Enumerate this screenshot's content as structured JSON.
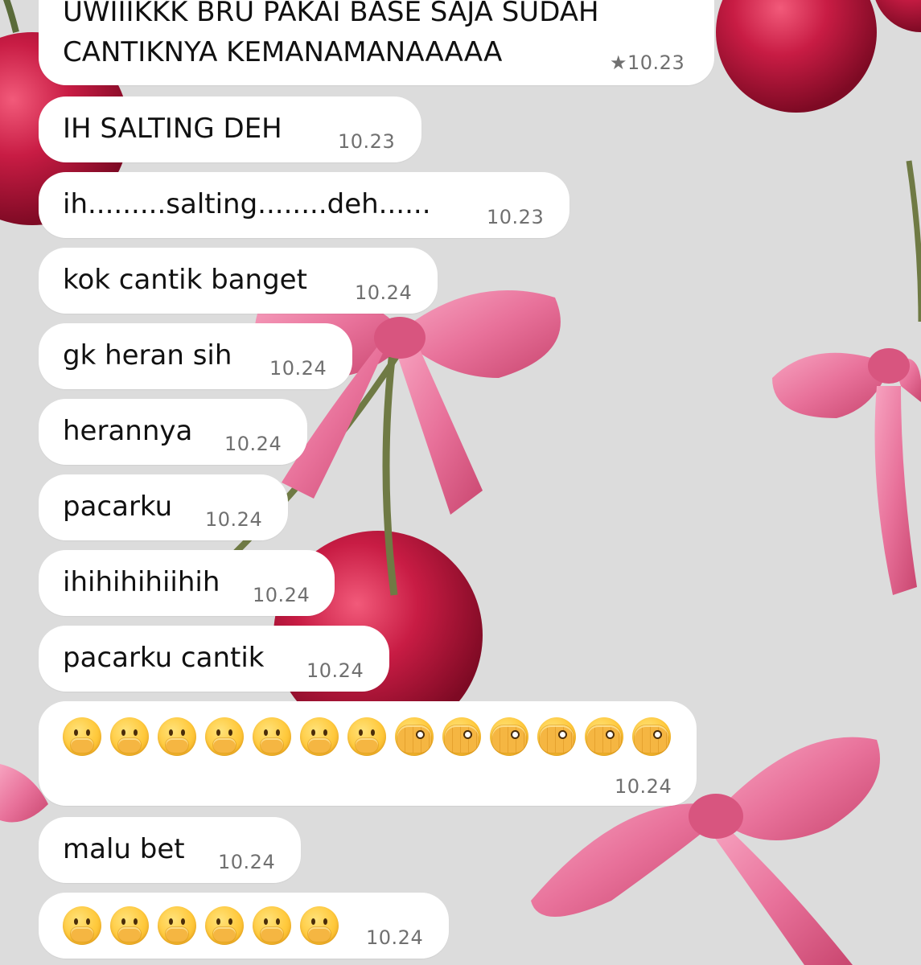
{
  "messages": [
    {
      "line1": "UWIIIKKK BRU PAKAI BASE SAJA SUDAH",
      "line2": "CANTIKNYA KEMANAMANAAAAA",
      "starred": true,
      "star": "★",
      "time": "10.23"
    },
    {
      "text": "IH SALTING DEH",
      "time": "10.23"
    },
    {
      "text": "ih.........salting........deh......",
      "time": "10.23"
    },
    {
      "text": "kok cantik banget",
      "time": "10.24"
    },
    {
      "text": "gk heran sih",
      "time": "10.24"
    },
    {
      "text": "herannya",
      "time": "10.24"
    },
    {
      "text": "pacarku",
      "time": "10.24"
    },
    {
      "text": "ihihihihiihih",
      "time": "10.24"
    },
    {
      "text": "pacarku cantik",
      "time": "10.24"
    },
    {
      "emojis": [
        "hand-over-mouth",
        "hand-over-mouth",
        "hand-over-mouth",
        "hand-over-mouth",
        "hand-over-mouth",
        "hand-over-mouth",
        "hand-over-mouth",
        "peeking-eye",
        "peeking-eye",
        "peeking-eye",
        "peeking-eye",
        "peeking-eye",
        "peeking-eye"
      ],
      "time": "10.24"
    },
    {
      "text": "malu bet",
      "time": "10.24"
    },
    {
      "emojis": [
        "hand-over-mouth",
        "hand-over-mouth",
        "hand-over-mouth",
        "hand-over-mouth",
        "hand-over-mouth",
        "hand-over-mouth"
      ],
      "time": "10.24"
    }
  ],
  "colors": {
    "background": "#dcdcdc",
    "bubble": "#ffffff",
    "text": "#111111",
    "timestamp": "#707070",
    "cherry": "#b8143a",
    "ribbon": "#e8719a"
  },
  "wallpaper": "cherries-with-pink-ribbon-bows"
}
